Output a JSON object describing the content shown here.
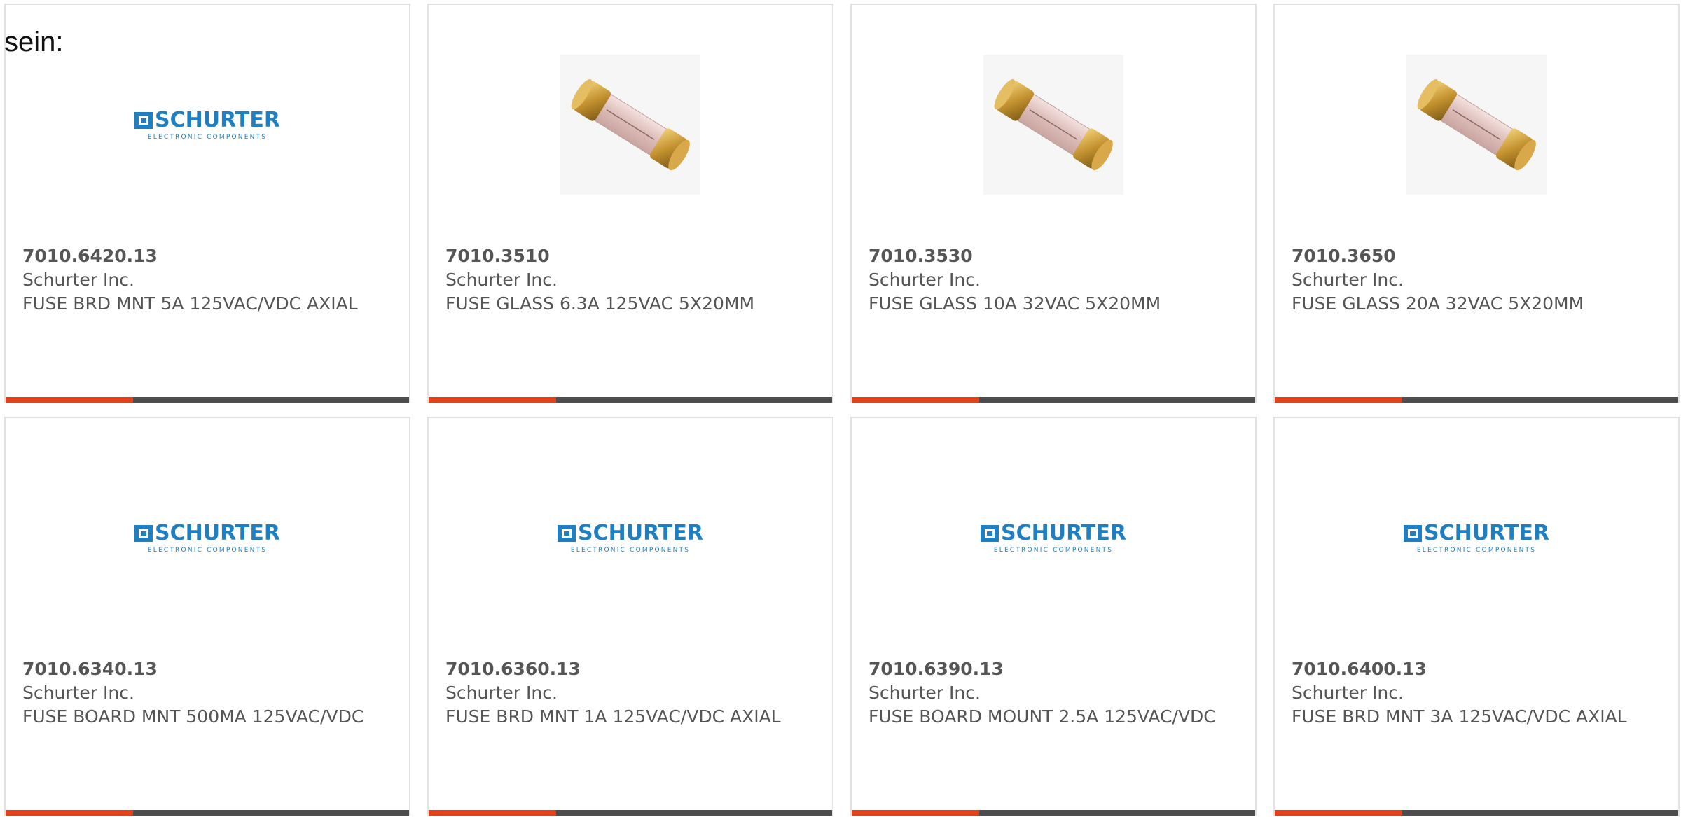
{
  "intro_text": "sein:",
  "colors": {
    "accent": "#e2421b",
    "footer_dark": "#4d4d4d",
    "brand_blue": "#1f7fc0",
    "text_gray": "#555555",
    "border": "#e2e2e2"
  },
  "logo": {
    "word": "SCHURTER",
    "sub": "ELECTRONIC COMPONENTS"
  },
  "products": [
    {
      "part_number": "7010.6420.13",
      "manufacturer": "Schurter Inc.",
      "description": "FUSE BRD MNT 5A 125VAC/VDC AXIAL",
      "image": "schurter-logo"
    },
    {
      "part_number": "7010.3510",
      "manufacturer": "Schurter Inc.",
      "description": "FUSE GLASS 6.3A 125VAC 5X20MM",
      "image": "glass-fuse-photo"
    },
    {
      "part_number": "7010.3530",
      "manufacturer": "Schurter Inc.",
      "description": "FUSE GLASS 10A 32VAC 5X20MM",
      "image": "glass-fuse-photo"
    },
    {
      "part_number": "7010.3650",
      "manufacturer": "Schurter Inc.",
      "description": "FUSE GLASS 20A 32VAC 5X20MM",
      "image": "glass-fuse-photo"
    },
    {
      "part_number": "7010.6340.13",
      "manufacturer": "Schurter Inc.",
      "description": "FUSE BOARD MNT 500MA 125VAC/VDC",
      "image": "schurter-logo"
    },
    {
      "part_number": "7010.6360.13",
      "manufacturer": "Schurter Inc.",
      "description": "FUSE BRD MNT 1A 125VAC/VDC AXIAL",
      "image": "schurter-logo"
    },
    {
      "part_number": "7010.6390.13",
      "manufacturer": "Schurter Inc.",
      "description": "FUSE BOARD MOUNT 2.5A 125VAC/VDC",
      "image": "schurter-logo"
    },
    {
      "part_number": "7010.6400.13",
      "manufacturer": "Schurter Inc.",
      "description": "FUSE BRD MNT 3A 125VAC/VDC AXIAL",
      "image": "schurter-logo"
    }
  ]
}
